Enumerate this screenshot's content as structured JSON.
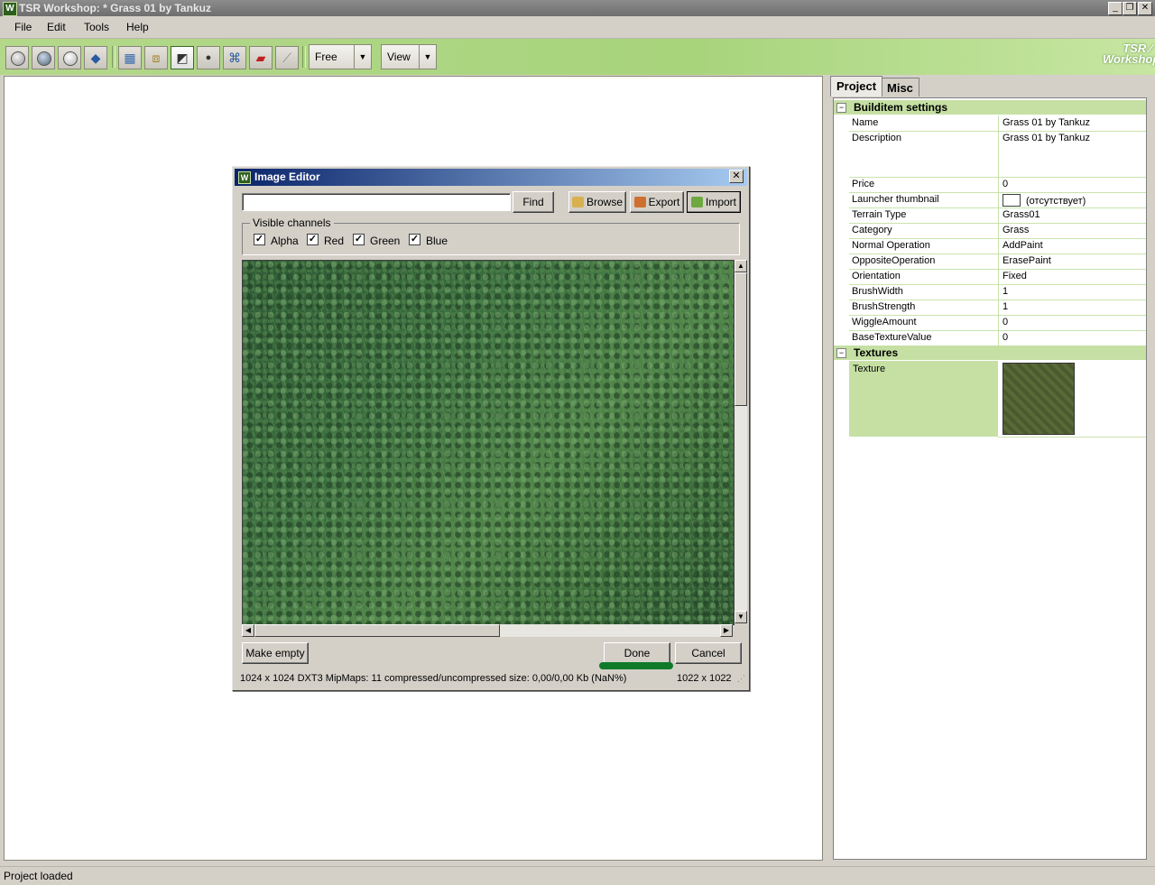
{
  "window": {
    "title": "TSR Workshop: * Grass 01 by Tankuz",
    "app_icon": "W"
  },
  "menu": [
    "File",
    "Edit",
    "Tools",
    "Help"
  ],
  "toolbar": {
    "mode_combo": "Free",
    "view_combo": "View",
    "logo_text": "TSR / Workshop"
  },
  "tabs": [
    "Project",
    "Misc"
  ],
  "properties": {
    "section_build": "Builditem settings",
    "rows": [
      {
        "name": "Name",
        "value": "Grass 01 by Tankuz"
      },
      {
        "name": "Description",
        "value": "Grass 01 by Tankuz"
      },
      {
        "name": "Price",
        "value": "0"
      },
      {
        "name": "Launcher thumbnail",
        "value": "(отсутствует)"
      },
      {
        "name": "Terrain Type",
        "value": "Grass01"
      },
      {
        "name": "Category",
        "value": "Grass"
      },
      {
        "name": "Normal Operation",
        "value": "AddPaint"
      },
      {
        "name": "OppositeOperation",
        "value": "ErasePaint"
      },
      {
        "name": "Orientation",
        "value": "Fixed"
      },
      {
        "name": "BrushWidth",
        "value": "1"
      },
      {
        "name": "BrushStrength",
        "value": "1"
      },
      {
        "name": "WiggleAmount",
        "value": "0"
      },
      {
        "name": "BaseTextureValue",
        "value": "0"
      }
    ],
    "section_textures": "Textures",
    "texture_label": "Texture"
  },
  "dialog": {
    "title": "Image Editor",
    "find_value": "",
    "find_label": "Find",
    "browse_label": "Browse",
    "export_label": "Export",
    "import_label": "Import",
    "channels_label": "Visible channels",
    "channels": [
      {
        "label": "Alpha",
        "checked": true
      },
      {
        "label": "Red",
        "checked": true
      },
      {
        "label": "Green",
        "checked": true
      },
      {
        "label": "Blue",
        "checked": true
      }
    ],
    "make_empty_label": "Make empty",
    "done_label": "Done",
    "cancel_label": "Cancel",
    "info_text": "1024 x 1024 DXT3 MipMaps: 11 compressed/uncompressed size: 0,00/0,00 Kb (NaN%)",
    "dimensions_text": "1022 x 1022"
  },
  "status": {
    "text": "Project loaded"
  },
  "colors": {
    "accent_green": "#a8d47c",
    "highlight_green": "#0f7a2a",
    "dialog_title": "#0a246a"
  }
}
